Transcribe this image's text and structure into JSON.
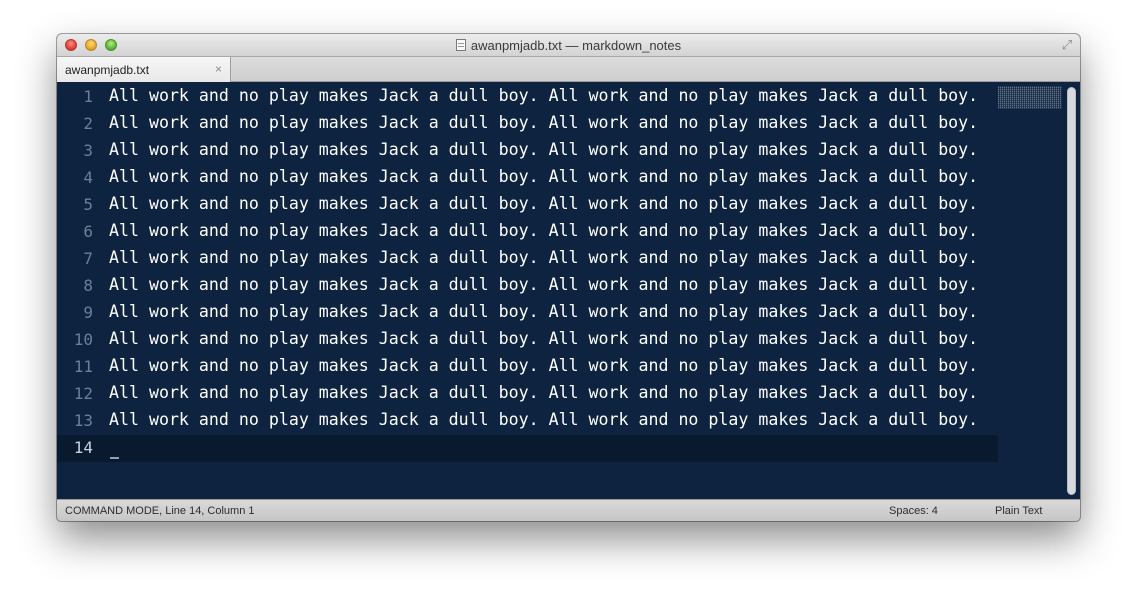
{
  "window": {
    "title": "awanpmjadb.txt — markdown_notes"
  },
  "tabs": [
    {
      "label": "awanpmjadb.txt",
      "close_glyph": "×"
    }
  ],
  "editor": {
    "lines": [
      {
        "number": "1",
        "text": "All work and no play makes Jack a dull boy. All work and no play makes Jack a dull boy."
      },
      {
        "number": "2",
        "text": "All work and no play makes Jack a dull boy. All work and no play makes Jack a dull boy."
      },
      {
        "number": "3",
        "text": "All work and no play makes Jack a dull boy. All work and no play makes Jack a dull boy."
      },
      {
        "number": "4",
        "text": "All work and no play makes Jack a dull boy. All work and no play makes Jack a dull boy."
      },
      {
        "number": "5",
        "text": "All work and no play makes Jack a dull boy. All work and no play makes Jack a dull boy."
      },
      {
        "number": "6",
        "text": "All work and no play makes Jack a dull boy. All work and no play makes Jack a dull boy."
      },
      {
        "number": "7",
        "text": "All work and no play makes Jack a dull boy. All work and no play makes Jack a dull boy."
      },
      {
        "number": "8",
        "text": "All work and no play makes Jack a dull boy. All work and no play makes Jack a dull boy."
      },
      {
        "number": "9",
        "text": "All work and no play makes Jack a dull boy. All work and no play makes Jack a dull boy."
      },
      {
        "number": "10",
        "text": "All work and no play makes Jack a dull boy. All work and no play makes Jack a dull boy."
      },
      {
        "number": "11",
        "text": "All work and no play makes Jack a dull boy. All work and no play makes Jack a dull boy."
      },
      {
        "number": "12",
        "text": "All work and no play makes Jack a dull boy. All work and no play makes Jack a dull boy."
      },
      {
        "number": "13",
        "text": "All work and no play makes Jack a dull boy. All work and no play makes Jack a dull boy."
      },
      {
        "number": "14",
        "text": ""
      }
    ],
    "current_line": "14"
  },
  "statusbar": {
    "mode": "COMMAND MODE, Line 14, Column 1",
    "spaces": "Spaces: 4",
    "syntax": "Plain Text"
  },
  "colors": {
    "editor_bg": "#0d2340",
    "text": "#ffffff",
    "gutter_text": "#6d7f96"
  },
  "icons": {
    "close": "close-icon",
    "minimize": "minimize-icon",
    "zoom": "zoom-icon",
    "document": "document-icon",
    "fullscreen": "fullscreen-icon"
  }
}
